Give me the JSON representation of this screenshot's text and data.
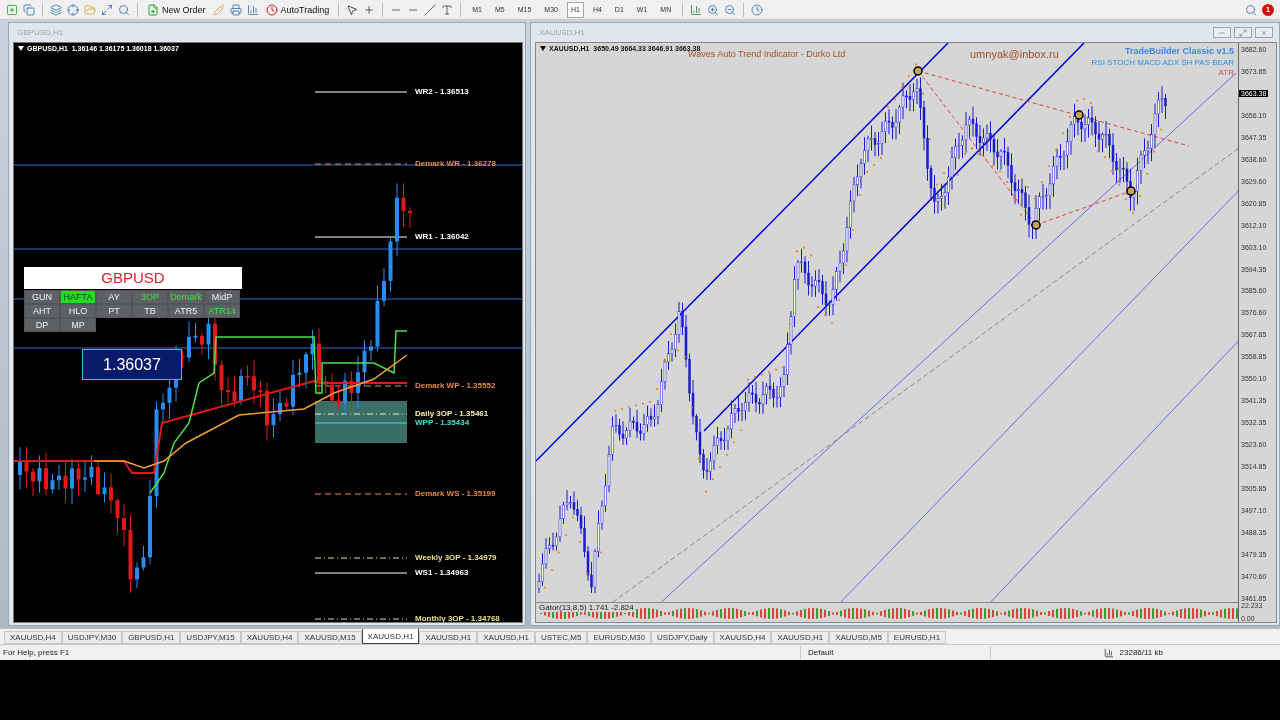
{
  "toolbar": {
    "new_order": "New Order",
    "auto_trading": "AutoTrading",
    "notification_count": "1",
    "timeframes": [
      {
        "label": "M1",
        "selected": false
      },
      {
        "label": "M5",
        "selected": false
      },
      {
        "label": "M15",
        "selected": false
      },
      {
        "label": "M30",
        "selected": false
      },
      {
        "label": "H1",
        "selected": true
      },
      {
        "label": "H4",
        "selected": false
      },
      {
        "label": "D1",
        "selected": false
      },
      {
        "label": "W1",
        "selected": false
      },
      {
        "label": "MN",
        "selected": false
      }
    ]
  },
  "left_chart": {
    "title": "GBPUSD,H1",
    "header": "GBPUSD,H1  1.36146 1.36175 1.36018 1.36037",
    "levels": [
      {
        "label": "WR2 - 1.36513",
        "color": "#ffffff",
        "kind": "solid"
      },
      {
        "label": "Demark WR - 1.36278",
        "color": "#e8893a",
        "kind": "dashed"
      },
      {
        "label": "WR1 - 1.36042",
        "color": "#ffffff",
        "kind": "solid"
      },
      {
        "label": "Demark WP - 1.35552",
        "color": "#e8893a",
        "kind": "dashed"
      },
      {
        "label": "Daily 3OP - 1.35461",
        "color": "#f3f0b0",
        "kind": "dashdot"
      },
      {
        "label": "WPP - 1.35434",
        "color": "#40e0d0",
        "kind": "solid"
      },
      {
        "label": "Demark WS - 1.35199",
        "color": "#e8893a",
        "kind": "dashed"
      },
      {
        "label": "Weekly 3OP - 1.34979",
        "color": "#e6e08a",
        "kind": "dashdot"
      },
      {
        "label": "WS1 - 1.34963",
        "color": "#ffffff",
        "kind": "solid"
      },
      {
        "label": "Monthly 3OP - 1.34768",
        "color": "#e6e08a",
        "kind": "dashdot"
      }
    ],
    "panel": {
      "title": "GBPUSD",
      "price": "1.36037",
      "buttons": [
        {
          "label": "GUN",
          "selected": false,
          "on": false
        },
        {
          "label": "HAFTA",
          "selected": true,
          "on": false
        },
        {
          "label": "AY",
          "selected": false,
          "on": false
        },
        {
          "label": "3OP",
          "selected": false,
          "on": true
        },
        {
          "label": "Demark",
          "selected": false,
          "on": true
        },
        {
          "label": "MidP",
          "selected": false,
          "on": false
        },
        {
          "label": "AHT",
          "selected": false,
          "on": false
        },
        {
          "label": "HLO",
          "selected": false,
          "on": false
        },
        {
          "label": "PT",
          "selected": false,
          "on": false
        },
        {
          "label": "TB",
          "selected": false,
          "on": false
        },
        {
          "label": "ATR5",
          "selected": false,
          "on": false
        },
        {
          "label": "ATR14",
          "selected": false,
          "on": true
        },
        {
          "label": "DP",
          "selected": false,
          "on": false
        },
        {
          "label": "MP",
          "selected": false,
          "on": false
        }
      ]
    }
  },
  "right_chart": {
    "title": "XAUUSD,H1",
    "header": "XAUUSD,H1  3650.49 3664.33 3646.91 3663.38",
    "indicator_name": "Waves Auto Trend Indicator - Durko Ltd",
    "email": "umnyak@inbox.ru",
    "tradebuilder": "TradeBuilder Classic v1.5",
    "tradebuilder_sub": "RSI STOCH MACD ADX SH PAS BEAR",
    "atr": "ATR",
    "subwindow_label": "Gator(13,8,5) 1.741 -2.824",
    "axis": [
      {
        "label": "3682.60",
        "kind": "tick"
      },
      {
        "label": "3673.85",
        "kind": "tick"
      },
      {
        "label": "3663.38",
        "kind": "current"
      },
      {
        "label": "3656.10",
        "kind": "tick"
      },
      {
        "label": "3647.35",
        "kind": "tick"
      },
      {
        "label": "3638.60",
        "kind": "tick"
      },
      {
        "label": "3629.60",
        "kind": "tick"
      },
      {
        "label": "3620.85",
        "kind": "tick"
      },
      {
        "label": "3612.10",
        "kind": "tick"
      },
      {
        "label": "3603.10",
        "kind": "tick"
      },
      {
        "label": "3594.35",
        "kind": "tick"
      },
      {
        "label": "3585.60",
        "kind": "tick"
      },
      {
        "label": "3576.60",
        "kind": "tick"
      },
      {
        "label": "3567.85",
        "kind": "tick"
      },
      {
        "label": "3558.85",
        "kind": "tick"
      },
      {
        "label": "3550.10",
        "kind": "tick"
      },
      {
        "label": "3541.35",
        "kind": "tick"
      },
      {
        "label": "3532.35",
        "kind": "tick"
      },
      {
        "label": "3523.60",
        "kind": "tick"
      },
      {
        "label": "3514.85",
        "kind": "tick"
      },
      {
        "label": "3505.85",
        "kind": "tick"
      },
      {
        "label": "3497.10",
        "kind": "tick"
      },
      {
        "label": "3488.35",
        "kind": "tick"
      },
      {
        "label": "3479.35",
        "kind": "tick"
      },
      {
        "label": "3470.60",
        "kind": "tick"
      },
      {
        "label": "3461.85",
        "kind": "tick"
      }
    ],
    "sub_axis": [
      "22.233",
      "0.00"
    ]
  },
  "tabs": [
    {
      "label": "XAUUSD,H4",
      "selected": false
    },
    {
      "label": "USDJPY,M30",
      "selected": false
    },
    {
      "label": "GBPUSD,H1",
      "selected": false
    },
    {
      "label": "USDJPY,M15",
      "selected": false
    },
    {
      "label": "XAUUSD,H4",
      "selected": false
    },
    {
      "label": "XAUUSD,M15",
      "selected": false
    },
    {
      "label": "XAUUSD,H1",
      "selected": true
    },
    {
      "label": "XAUUSD,H1",
      "selected": false
    },
    {
      "label": "XAUUSD,H1",
      "selected": false
    },
    {
      "label": "USTEC,M5",
      "selected": false
    },
    {
      "label": "EURUSD,M30",
      "selected": false
    },
    {
      "label": "USDJPY,Daily",
      "selected": false
    },
    {
      "label": "XAUUSD,H4",
      "selected": false
    },
    {
      "label": "XAUUSD,H1",
      "selected": false
    },
    {
      "label": "XAUUSD,M5",
      "selected": false
    },
    {
      "label": "EURUSD,H1",
      "selected": false
    }
  ],
  "status_bar": {
    "help": "For Help, press F1",
    "profile": "Default",
    "traffic": "23286/11 kb"
  }
}
